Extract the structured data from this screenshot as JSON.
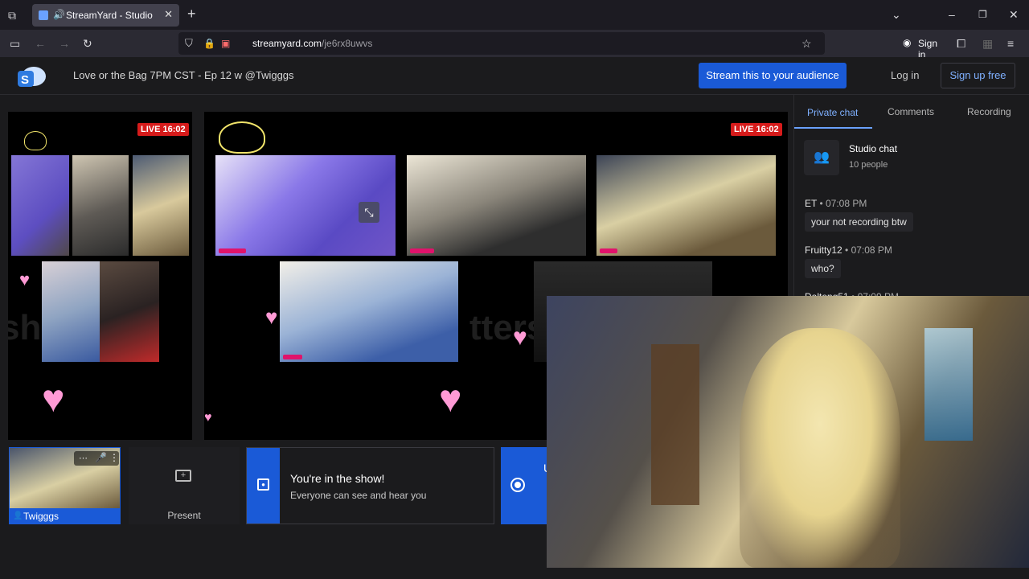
{
  "browser": {
    "tab_title": "StreamYard - Studio",
    "url_host": "streamyard.com",
    "url_path": "/je6rx8uwvs",
    "sign_in_label": "Sign in"
  },
  "header": {
    "broadcast_title": "Love or the Bag 7PM CST - Ep 12 w @Twigggs",
    "stream_button": "Stream this to your audience",
    "login": "Log in",
    "signup": "Sign up free"
  },
  "stage": {
    "live_badge": "LIVE 16:02"
  },
  "sidebar": {
    "tabs": [
      "Private chat",
      "Comments",
      "Recording"
    ],
    "studio_chat_title": "Studio chat",
    "studio_chat_count": "10 people",
    "messages": [
      {
        "author": "ET",
        "time": "07:08 PM",
        "text": "your not recording btw"
      },
      {
        "author": "Fruitty12",
        "time": "07:08 PM",
        "text": "who?"
      },
      {
        "author": "Daltong51",
        "time": "07:09 PM",
        "text": ""
      }
    ]
  },
  "bottom": {
    "self_name": "Twigggs",
    "present_label": "Present",
    "show_title": "You're in the show!",
    "show_subtitle": "Everyone can see and hear you"
  },
  "colors": {
    "accent": "#1a5ad7",
    "live": "#d61b1b",
    "heart": "#ff9ad5"
  }
}
